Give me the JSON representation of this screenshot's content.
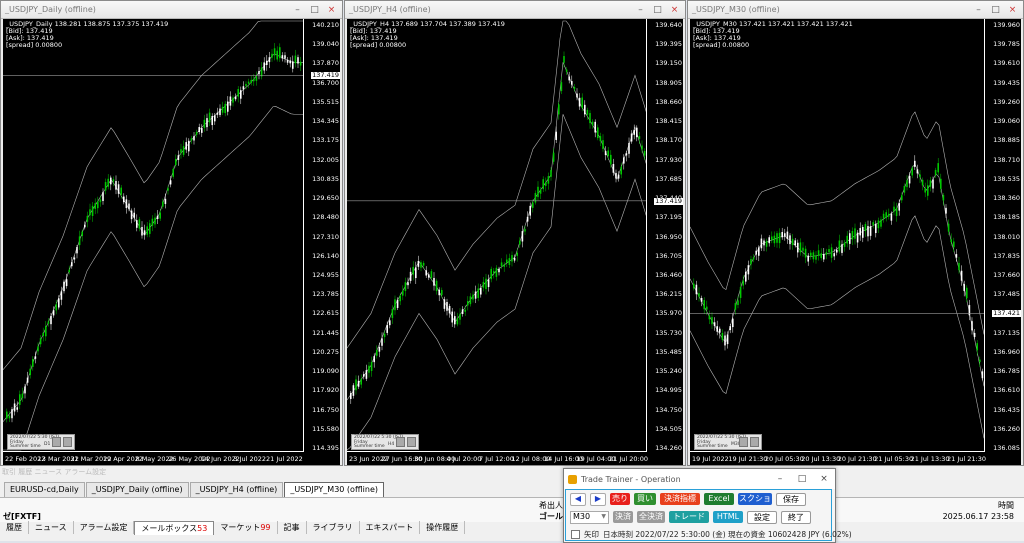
{
  "windows": [
    {
      "title": "_USDJPY_Daily (offline)",
      "info": [
        "_USDJPY_Daily  138.281 138.875 137.375 137.419",
        "[Bid]: 137.419",
        "[Ask]: 137.419",
        "[spread] 0.00800"
      ],
      "price_labels": [
        "140.210",
        "139.040",
        "137.870",
        "136.700",
        "135.515",
        "134.345",
        "133.175",
        "132.005",
        "130.835",
        "129.650",
        "128.480",
        "127.310",
        "126.140",
        "124.955",
        "123.785",
        "122.615",
        "121.445",
        "120.275",
        "119.090",
        "117.920",
        "116.750",
        "115.580",
        "114.395"
      ],
      "current_price": "137.419",
      "time_labels": [
        "22 Feb 2022",
        "13 Mar 2022",
        "31 Mar 2022",
        "19 Apr 2022",
        "8 May 2022",
        "26 May 2022",
        "14 Jun 2022",
        "3 Jul 2022",
        "21 Jul 2022"
      ],
      "mini_info": [
        "2022/07/22 5:30 (JST)",
        "Friday",
        "Summer time"
      ],
      "mini_code": "D1",
      "ylim": [
        114.395,
        140.21
      ]
    },
    {
      "title": "_USDJPY_H4 (offline)",
      "info": [
        "_USDJPY_H4  137.689 137.704 137.389 137.419",
        "[Bid]: 137.419",
        "[Ask]: 137.419",
        "[spread] 0.00800"
      ],
      "price_labels": [
        "139.640",
        "139.395",
        "139.150",
        "138.905",
        "138.660",
        "138.415",
        "138.170",
        "137.930",
        "137.685",
        "137.440",
        "137.195",
        "136.950",
        "136.705",
        "136.460",
        "136.215",
        "135.970",
        "135.730",
        "135.485",
        "135.240",
        "134.995",
        "134.750",
        "134.505",
        "134.260"
      ],
      "current_price": "137.419",
      "time_labels": [
        "23 Jun 2022",
        "27 Jun 16:00",
        "30 Jun 08:00",
        "4 Jul 20:00",
        "7 Jul 12:00",
        "12 Jul 08:00",
        "14 Jul 16:00",
        "19 Jul 04:00",
        "21 Jul 20:00"
      ],
      "mini_info": [
        "2022/07/22 5:30 (JST)",
        "Friday",
        "Summer time"
      ],
      "mini_code": "H4",
      "ylim": [
        134.26,
        139.64
      ]
    },
    {
      "title": "_USDJPY_M30 (offline)",
      "info": [
        "_USDJPY_M30  137.421 137.421 137.421 137.421",
        "[Bid]: 137.419",
        "[Ask]: 137.419",
        "[spread] 0.00800"
      ],
      "price_labels": [
        "139.960",
        "139.785",
        "139.610",
        "139.435",
        "139.260",
        "139.060",
        "138.885",
        "138.710",
        "138.535",
        "138.360",
        "138.185",
        "138.010",
        "137.835",
        "137.660",
        "137.485",
        "137.310",
        "137.135",
        "136.960",
        "136.785",
        "136.610",
        "136.435",
        "136.260",
        "136.085"
      ],
      "current_price": "137.421",
      "time_labels": [
        "19 Jul 2022",
        "19 Jul 21:30",
        "20 Jul 05:30",
        "20 Jul 13:30",
        "20 Jul 21:30",
        "21 Jul 05:30",
        "21 Jul 13:30",
        "21 Jul 21:30"
      ],
      "mini_info": [
        "2022/07/22 5:30 (JST)",
        "Friday",
        "Summer time"
      ],
      "mini_code": "M30",
      "ylim": [
        136.085,
        139.96
      ]
    }
  ],
  "colors": {
    "chart_bg": "#000000",
    "bull_candle": "#00c800",
    "bear_candle": "#ffffff",
    "bands": "#b4b4b4"
  },
  "window_controls": [
    "–",
    "□",
    "×"
  ],
  "terminal": {
    "hint": "取引 履歴  ニュース  アラーム設定",
    "chart_tabs": [
      "EURUSD-cd,Daily",
      "_USDJPY_Daily (offline)",
      "_USDJPY_H4 (offline)",
      "_USDJPY_M30 (offline)"
    ],
    "active_tab": 3,
    "left_label": "ゼ[FXTF]",
    "col_header_left": "希出人",
    "col_value_left": "ゴールデン...",
    "col_header_time": "時間",
    "col_value_time": "2025.06.17 23:58",
    "bottom_tabs": [
      "履歴",
      "ニュース",
      "アラーム設定",
      "メールボックス",
      "マーケット",
      "記事",
      "ライブラリ",
      "エキスパート",
      "操作履歴"
    ],
    "mailbox_count": "53",
    "market_count": "99"
  },
  "trade_trainer": {
    "title": "Trade Trainer - Operation",
    "controls": [
      "–",
      "□",
      "×"
    ],
    "nav_prev": "◀",
    "nav_next": "▶",
    "timeframe": "M30",
    "buttons_row1": [
      {
        "label": "売り",
        "color": "#e8201c"
      },
      {
        "label": "買い",
        "color": "#2f8f2f"
      },
      {
        "label": "決済指標",
        "color": "#e8401c"
      },
      {
        "label": "Excel",
        "color": "#1f7d2f"
      },
      {
        "label": "スクショ",
        "color": "#1f5fd0"
      },
      {
        "label": "保存",
        "color": "#ffffff"
      }
    ],
    "buttons_row2": [
      {
        "label": "決済",
        "color": "#9a9a9a"
      },
      {
        "label": "全決済",
        "color": "#9a9a9a"
      },
      {
        "label": "トレード",
        "color": "#1fa0a0"
      },
      {
        "label": "HTML",
        "color": "#1fa0c8"
      },
      {
        "label": "設定",
        "color": "#ffffff"
      },
      {
        "label": "終了",
        "color": "#ffffff"
      }
    ],
    "checkbox_label": "矢印",
    "status": "日本時刻 2022/07/22 5:30:00 (金)   現在の資金 10602428 JPY (6.02%)"
  }
}
